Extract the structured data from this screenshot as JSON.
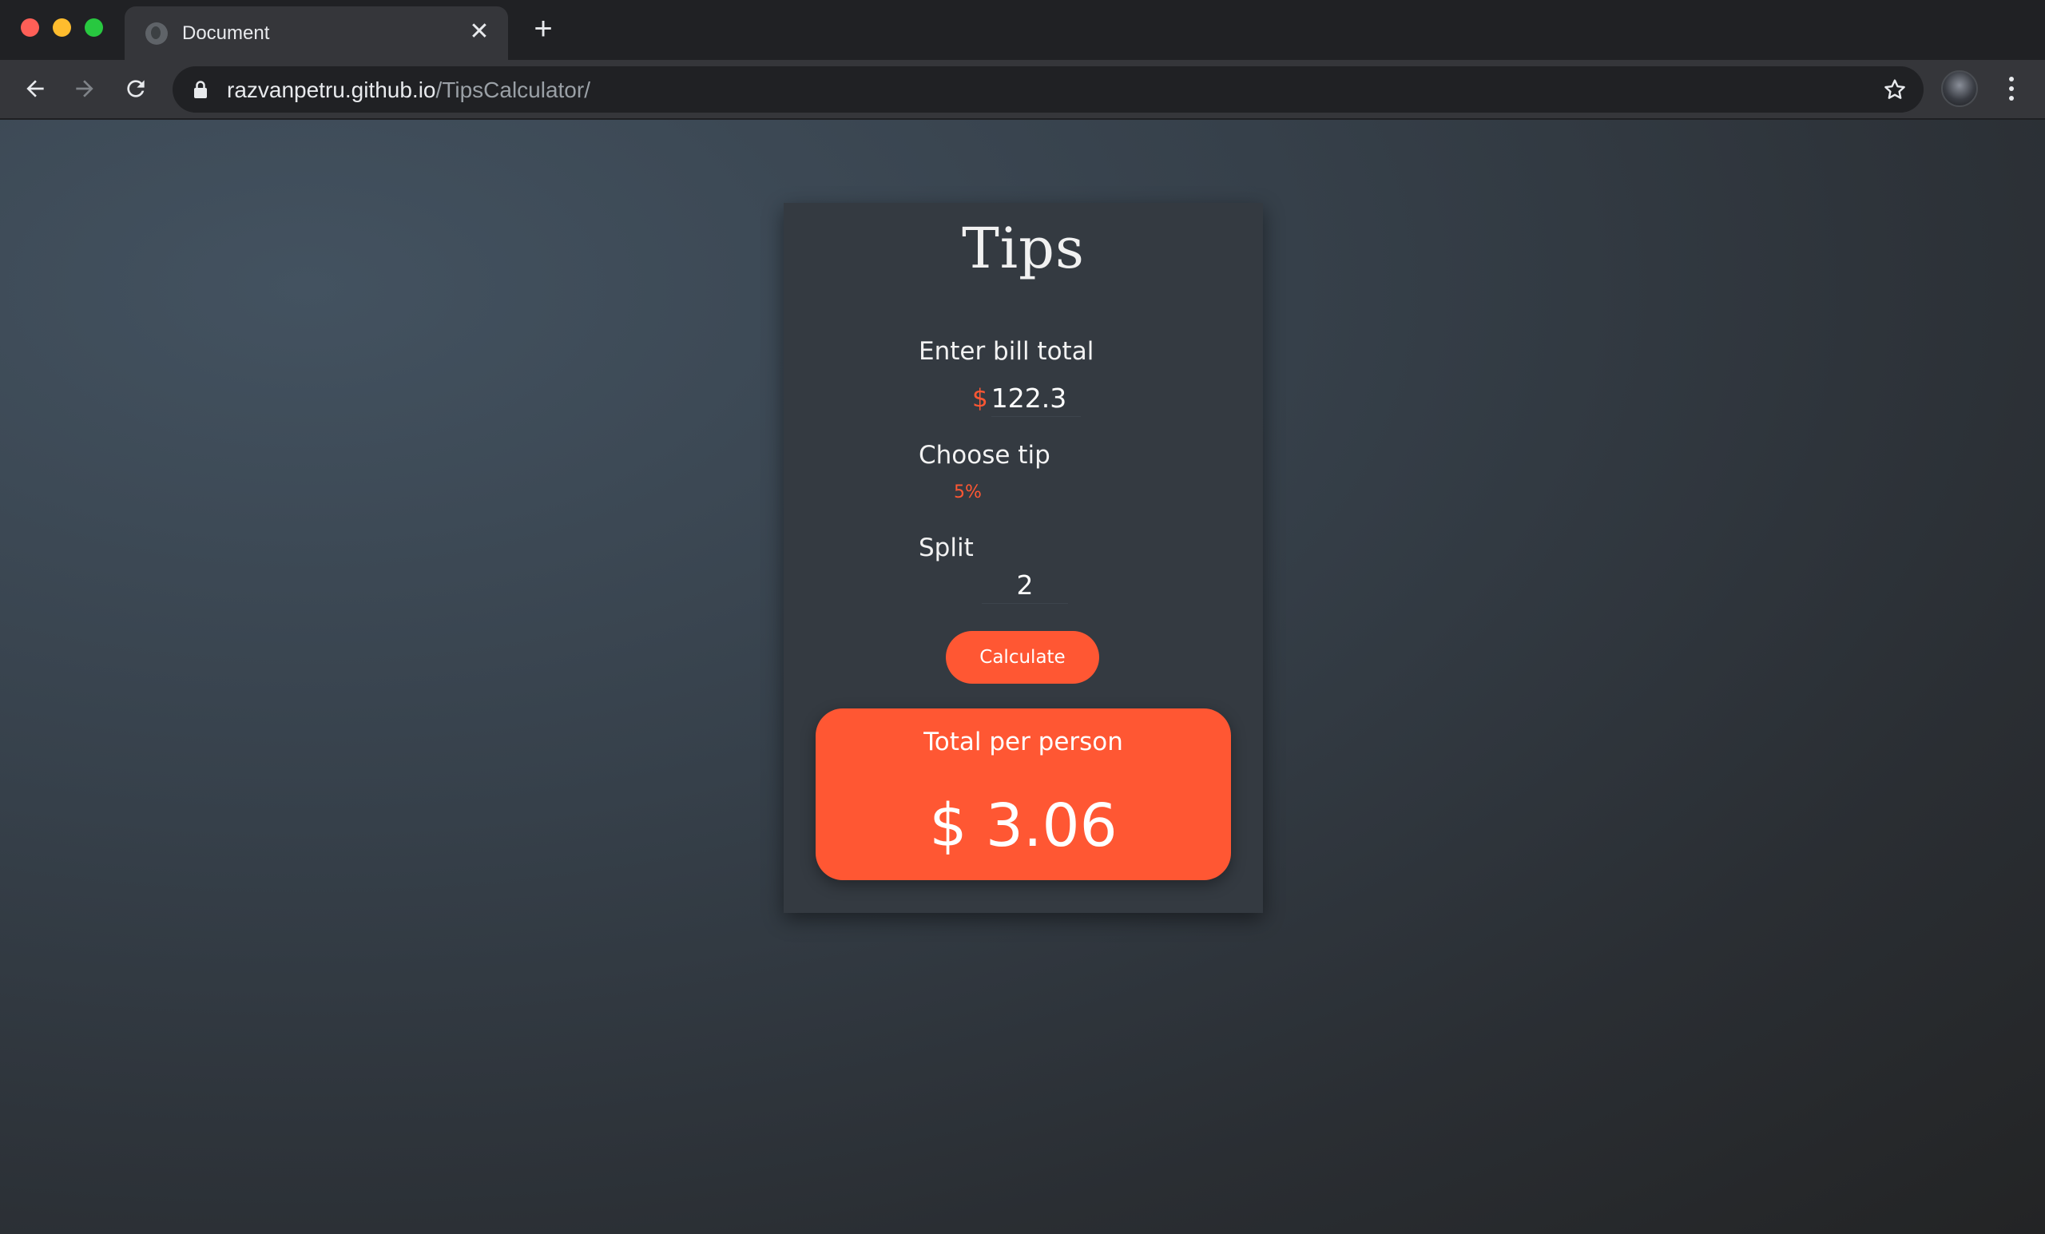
{
  "browser": {
    "tab_title": "Document",
    "tab_close_label": "✕",
    "new_tab_label": "+",
    "url_host": "razvanpetru.github.io",
    "url_path": "/TipsCalculator/"
  },
  "app": {
    "title": "Tips",
    "bill": {
      "label": "Enter bill total",
      "currency": "$",
      "value": "122.3"
    },
    "tip": {
      "label": "Choose tip",
      "selected": "5%"
    },
    "split": {
      "label": "Split",
      "value": "2"
    },
    "calculate_label": "Calculate",
    "result": {
      "label": "Total per person",
      "value": "$ 3.06"
    }
  },
  "colors": {
    "accent": "#ff5733",
    "card_bg": "#343a41",
    "chrome_bg": "#202124",
    "toolbar_bg": "#35363a"
  }
}
